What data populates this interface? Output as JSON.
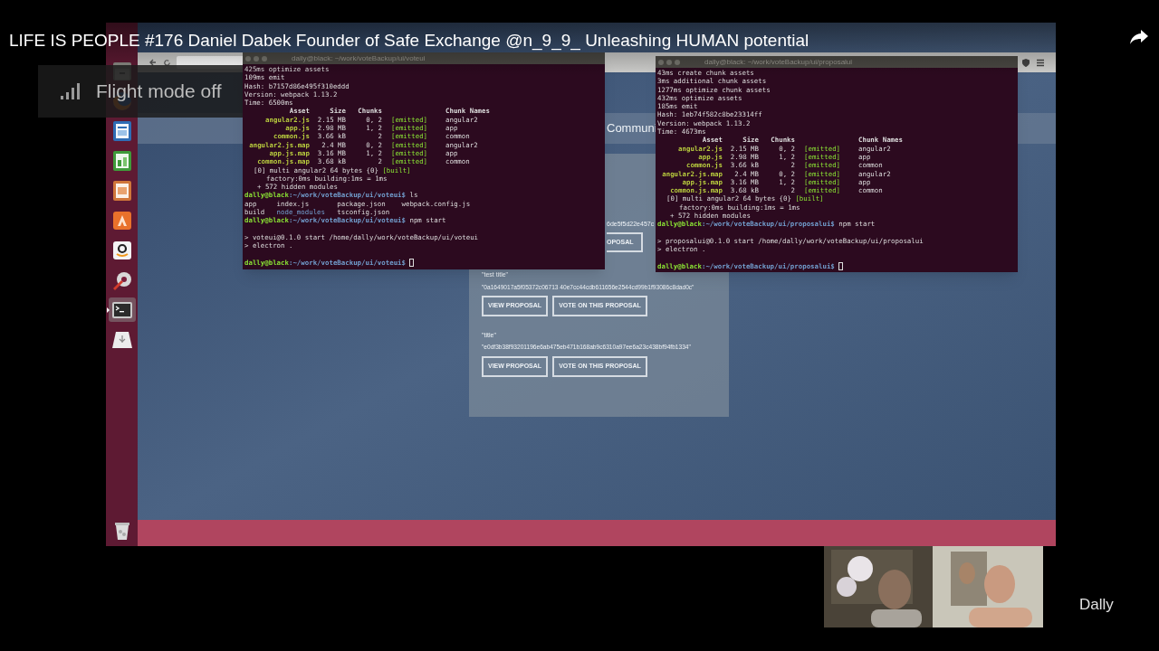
{
  "video_title": "LIFE IS PEOPLE #176 Daniel Dabek Founder of Safe Exchange @n_9_9_ Unleashing HUMAN potential",
  "toast": {
    "text": "Flight mode off"
  },
  "launcher": {
    "items": [
      {
        "kind": "files",
        "selected": false
      },
      {
        "kind": "firefox",
        "selected": false
      },
      {
        "kind": "writer",
        "selected": false
      },
      {
        "kind": "calc",
        "selected": false
      },
      {
        "kind": "impress",
        "selected": false
      },
      {
        "kind": "software",
        "selected": false
      },
      {
        "kind": "amazon",
        "selected": false
      },
      {
        "kind": "settings",
        "selected": false
      },
      {
        "kind": "terminal",
        "selected": true
      },
      {
        "kind": "drive",
        "selected": false
      }
    ],
    "trash": {
      "kind": "trash"
    }
  },
  "browser": {
    "header_fragment": "Communi",
    "card": {
      "hash_fragment": "6de5f5d22e457c",
      "button_fragment": "OPOSAL",
      "proposals": [
        {
          "title": "\"test title\"",
          "hash": "\"0a1649017a5f05372c06713 40e7cc44cdb611656e2544cd99b1f93086c8dad0c\"",
          "buttons": [
            "VIEW PROPOSAL",
            "VOTE ON THIS PROPOSAL"
          ]
        },
        {
          "title": "\"title\"",
          "hash": "\"e0df3b38f93201196e6ab475eb471b168ab9c6310a97ee6a23c438bf94fb1334\"",
          "buttons": [
            "VIEW PROPOSAL",
            "VOTE ON THIS PROPOSAL"
          ]
        }
      ]
    }
  },
  "terminals": [
    {
      "title": "dally@black: ~/work/voteBackup/ui/voteui",
      "lines": [
        {
          "kind": "plain",
          "text": "425ms optimize assets"
        },
        {
          "kind": "plain",
          "text": "109ms emit"
        },
        {
          "kind": "plain",
          "text": "Hash: b7157d86e495f310eddd"
        },
        {
          "kind": "plain",
          "text": "Version: webpack 1.13.2"
        },
        {
          "kind": "plain",
          "text": "Time: 6500ms"
        },
        {
          "kind": "header",
          "cells": [
            "Asset",
            "Size",
            "Chunks",
            "Chunk Names"
          ]
        },
        {
          "kind": "asset",
          "cells": [
            "angular2.js",
            "2.15 MB",
            "0, 2",
            "[emitted]",
            "angular2"
          ]
        },
        {
          "kind": "asset",
          "cells": [
            "app.js",
            "2.98 MB",
            "1, 2",
            "[emitted]",
            "app"
          ]
        },
        {
          "kind": "asset",
          "cells": [
            "common.js",
            "3.66 kB",
            "2",
            "[emitted]",
            "common"
          ]
        },
        {
          "kind": "asset",
          "cells": [
            "angular2.js.map",
            "2.4 MB",
            "0, 2",
            "[emitted]",
            "angular2"
          ]
        },
        {
          "kind": "asset",
          "cells": [
            "app.js.map",
            "3.16 MB",
            "1, 2",
            "[emitted]",
            "app"
          ]
        },
        {
          "kind": "asset",
          "cells": [
            "common.js.map",
            "3.68 kB",
            "2",
            "[emitted]",
            "common"
          ]
        },
        {
          "kind": "built",
          "text": "[0] multi angular2 64 bytes {0}",
          "flag": "[built]"
        },
        {
          "kind": "detail",
          "text": "factory:0ms building:1ms = 1ms"
        },
        {
          "kind": "summary",
          "text": "+ 572 hidden modules"
        },
        {
          "kind": "prompt",
          "user": "dally@black",
          "path": ":~/work/voteBackup/ui/voteui$",
          "command": "ls",
          "cursor": false
        },
        {
          "kind": "ls",
          "cells": [
            "app",
            "index.js",
            "package.json",
            "webpack.config.js"
          ]
        },
        {
          "kind": "ls",
          "cells": [
            "build",
            "node_modules",
            "tsconfig.json"
          ]
        },
        {
          "kind": "prompt",
          "user": "dally@black",
          "path": ":~/work/voteBackup/ui/voteui$",
          "command": "npm start",
          "cursor": false
        },
        {
          "kind": "blank"
        },
        {
          "kind": "plain",
          "text": "> voteui@0.1.0 start /home/dally/work/voteBackup/ui/voteui"
        },
        {
          "kind": "plain",
          "text": "> electron ."
        },
        {
          "kind": "blank"
        },
        {
          "kind": "prompt",
          "user": "dally@black",
          "path": ":~/work/voteBackup/ui/voteui$",
          "cursor": true
        }
      ]
    },
    {
      "title": "dally@black: ~/work/voteBackup/ui/proposalui",
      "lines": [
        {
          "kind": "plain",
          "text": "43ms create chunk assets"
        },
        {
          "kind": "plain",
          "text": "3ms additional chunk assets"
        },
        {
          "kind": "plain",
          "text": "1277ms optimize chunk assets"
        },
        {
          "kind": "plain",
          "text": "432ms optimize assets"
        },
        {
          "kind": "plain",
          "text": "185ms emit"
        },
        {
          "kind": "plain",
          "text": "Hash: 1eb74f582c8be23314ff"
        },
        {
          "kind": "plain",
          "text": "Version: webpack 1.13.2"
        },
        {
          "kind": "plain",
          "text": "Time: 4673ms"
        },
        {
          "kind": "header",
          "cells": [
            "Asset",
            "Size",
            "Chunks",
            "Chunk Names"
          ]
        },
        {
          "kind": "asset",
          "cells": [
            "angular2.js",
            "2.15 MB",
            "0, 2",
            "[emitted]",
            "angular2"
          ]
        },
        {
          "kind": "asset",
          "cells": [
            "app.js",
            "2.98 MB",
            "1, 2",
            "[emitted]",
            "app"
          ]
        },
        {
          "kind": "asset",
          "cells": [
            "common.js",
            "3.66 kB",
            "2",
            "[emitted]",
            "common"
          ]
        },
        {
          "kind": "asset",
          "cells": [
            "angular2.js.map",
            "2.4 MB",
            "0, 2",
            "[emitted]",
            "angular2"
          ]
        },
        {
          "kind": "asset",
          "cells": [
            "app.js.map",
            "3.16 MB",
            "1, 2",
            "[emitted]",
            "app"
          ]
        },
        {
          "kind": "asset",
          "cells": [
            "common.js.map",
            "3.68 kB",
            "2",
            "[emitted]",
            "common"
          ]
        },
        {
          "kind": "built",
          "text": "[0] multi angular2 64 bytes {0}",
          "flag": "[built]"
        },
        {
          "kind": "detail",
          "text": "factory:0ms building:1ms = 1ms"
        },
        {
          "kind": "summary",
          "text": "+ 572 hidden modules"
        },
        {
          "kind": "prompt",
          "user": "dally@black",
          "path": ":~/work/voteBackup/ui/proposalui$",
          "command": "npm start",
          "cursor": false
        },
        {
          "kind": "blank"
        },
        {
          "kind": "plain",
          "text": "> proposalui@0.1.0 start /home/dally/work/voteBackup/ui/proposalui"
        },
        {
          "kind": "plain",
          "text": "> electron ."
        },
        {
          "kind": "blank"
        },
        {
          "kind": "prompt",
          "user": "dally@black",
          "path": ":~/work/voteBackup/ui/proposalui$",
          "cursor": true
        }
      ]
    }
  ],
  "webcam": {
    "kind": "picture",
    "speaker": "Dally"
  }
}
